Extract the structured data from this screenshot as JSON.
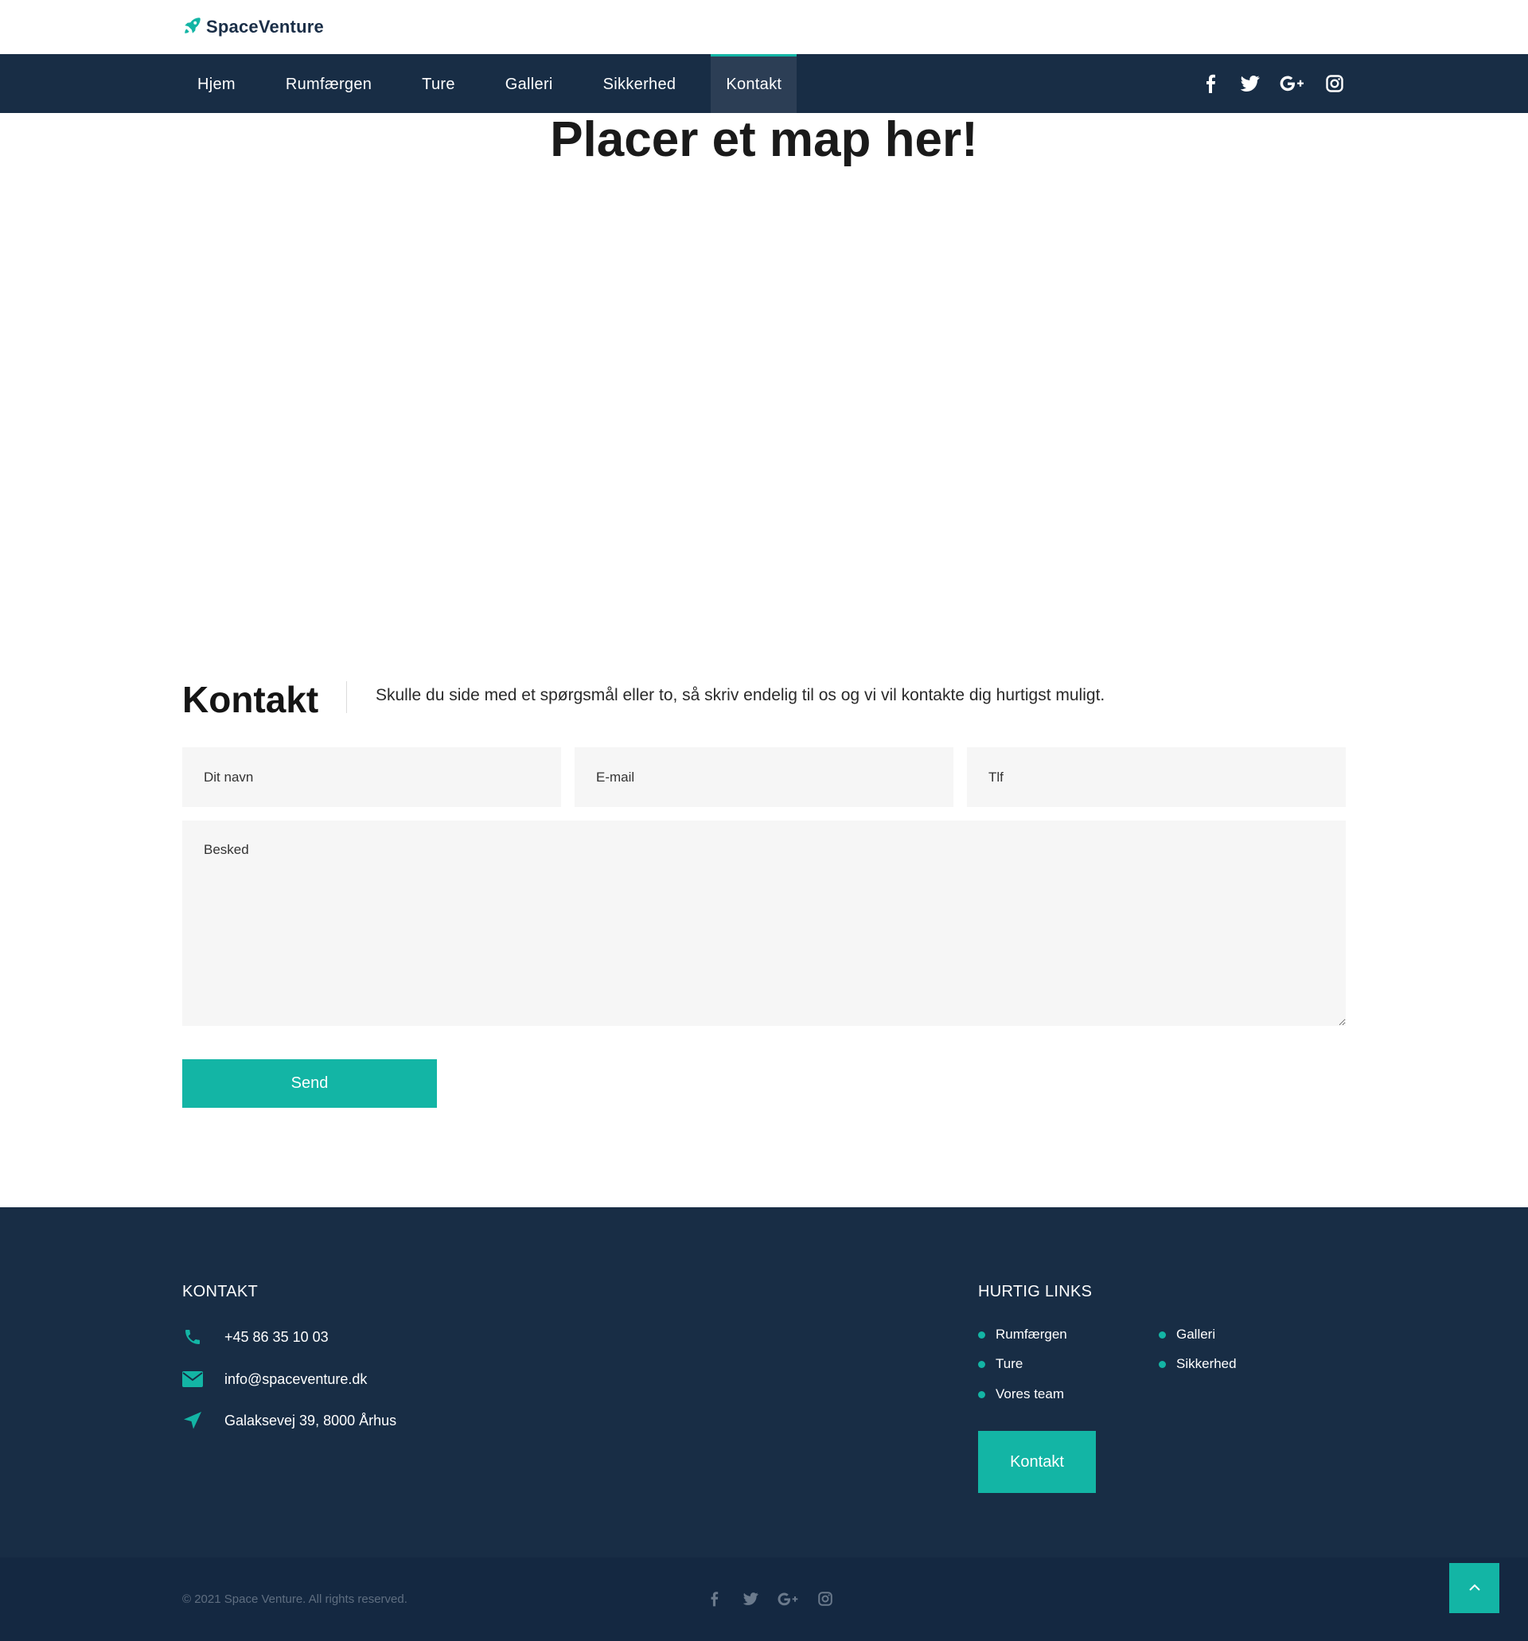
{
  "brand": {
    "name": "SpaceVenture",
    "accent": "#13b5a5",
    "navy": "#182d45",
    "icon": "rocket-icon"
  },
  "nav": {
    "items": [
      {
        "label": "Hjem",
        "active": false
      },
      {
        "label": "Rumfærgen",
        "active": false
      },
      {
        "label": "Ture",
        "active": false
      },
      {
        "label": "Galleri",
        "active": false
      },
      {
        "label": "Sikkerhed",
        "active": false
      },
      {
        "label": "Kontakt",
        "active": true
      }
    ],
    "social_icons": [
      "facebook-icon",
      "twitter-icon",
      "google-plus-icon",
      "instagram-icon"
    ]
  },
  "map": {
    "heading": "Placer et map her!"
  },
  "contact": {
    "title": "Kontakt",
    "intro": "Skulle du side med et spørgsmål eller to, så skriv endelig til os og vi vil kontakte dig hurtigst muligt.",
    "fields": {
      "name_placeholder": "Dit navn",
      "email_placeholder": "E-mail",
      "phone_placeholder": "Tlf",
      "message_placeholder": "Besked"
    },
    "send_label": "Send"
  },
  "footer": {
    "contact_heading": "KONTAKT",
    "phone": "+45 86 35 10 03",
    "email": "info@spaceventure.dk",
    "address": "Galaksevej 39, 8000 Århus",
    "quick_heading": "HURTIG LINKS",
    "quick_links": [
      "Rumfærgen",
      "Galleri",
      "Ture",
      "Sikkerhed",
      "Vores team"
    ],
    "kontakt_button": "Kontakt"
  },
  "bottom": {
    "copyright": "© 2021 Space Venture. All rights reserved."
  }
}
